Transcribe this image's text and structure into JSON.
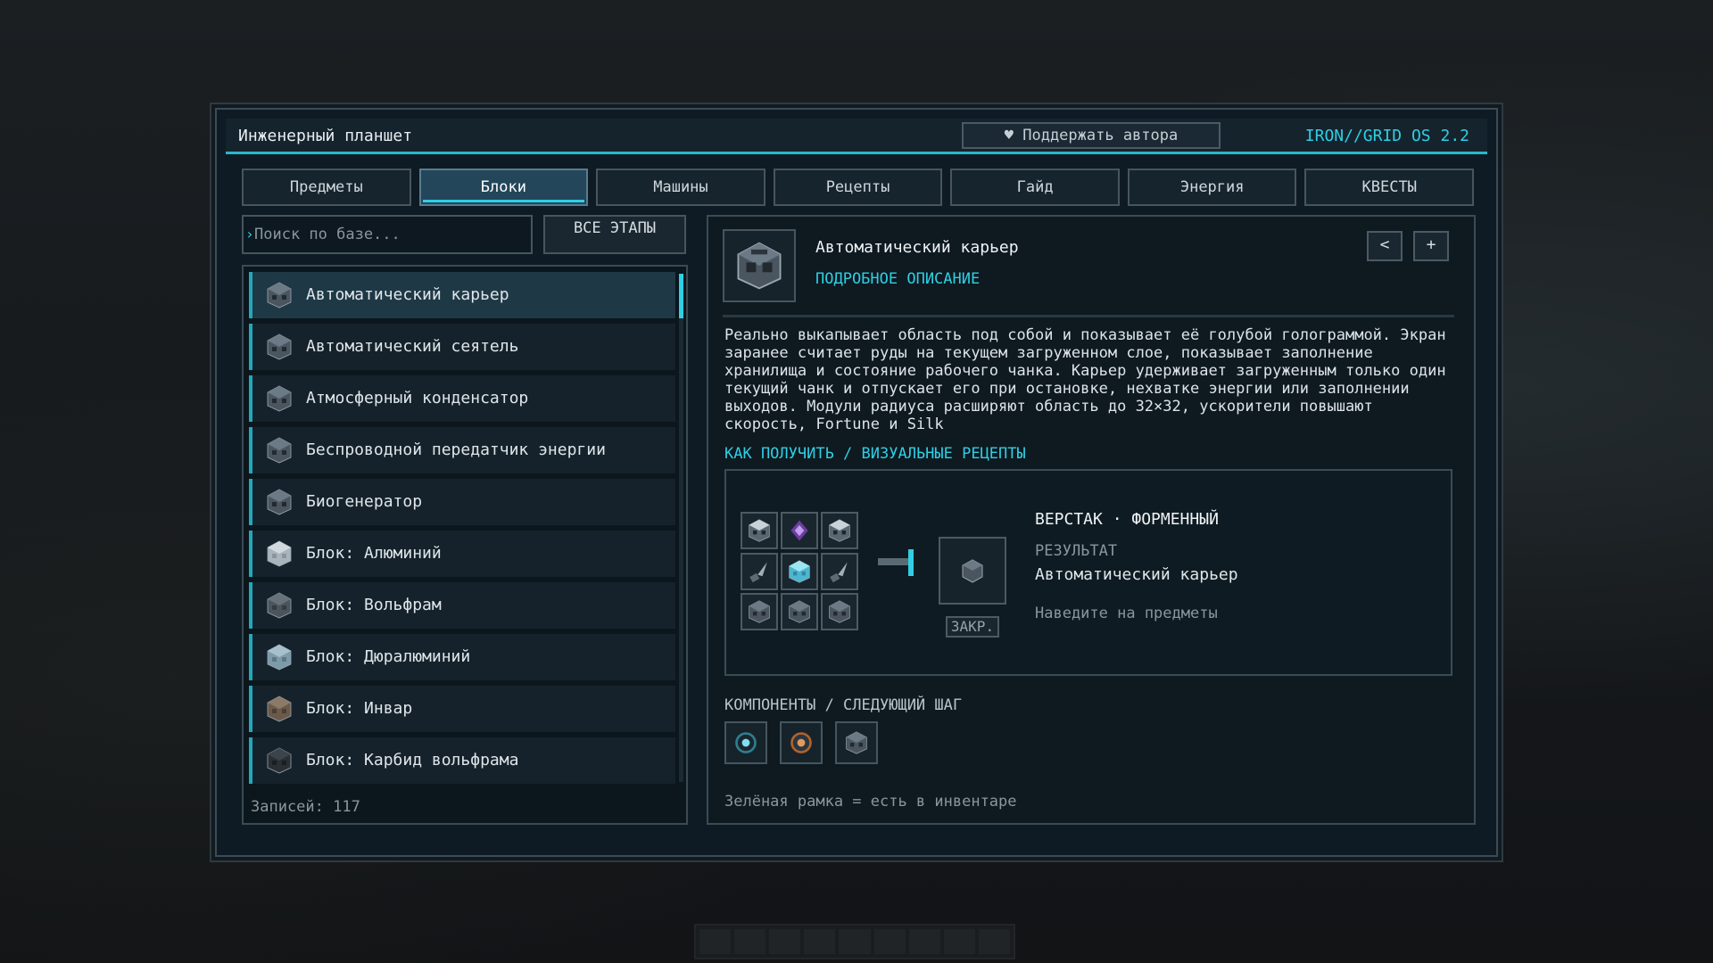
{
  "window": {
    "title": "Инженерный планшет",
    "support_button": "♥ Поддержать автора",
    "version": "IRON//GRID OS 2.2",
    "accent_color": "#2fcfe4"
  },
  "tabs": [
    {
      "label": "Предметы",
      "active": false
    },
    {
      "label": "Блоки",
      "active": true
    },
    {
      "label": "Машины",
      "active": false
    },
    {
      "label": "Рецепты",
      "active": false
    },
    {
      "label": "Гайд",
      "active": false
    },
    {
      "label": "Энергия",
      "active": false
    },
    {
      "label": "КВЕСТЫ",
      "active": false
    }
  ],
  "search": {
    "placeholder": "Поиск по базе...",
    "value": "",
    "filter_button": "ВСЕ ЭТАПЫ"
  },
  "list": {
    "items": [
      {
        "label": "Автоматический карьер",
        "icon": "machine-block-icon",
        "selected": true
      },
      {
        "label": "Автоматический сеятель",
        "icon": "machine-block-icon",
        "selected": false
      },
      {
        "label": "Атмосферный конденсатор",
        "icon": "machine-block-icon",
        "selected": false
      },
      {
        "label": "Беспроводной передатчик энергии",
        "icon": "machine-block-icon",
        "selected": false
      },
      {
        "label": "Биогенератор",
        "icon": "machine-block-icon",
        "selected": false
      },
      {
        "label": "Блок: Алюминий",
        "icon": "aluminium-block-icon",
        "selected": false
      },
      {
        "label": "Блок: Вольфрам",
        "icon": "tungsten-block-icon",
        "selected": false
      },
      {
        "label": "Блок: Дюралюминий",
        "icon": "duralumin-block-icon",
        "selected": false
      },
      {
        "label": "Блок: Инвар",
        "icon": "invar-block-icon",
        "selected": false
      },
      {
        "label": "Блок: Карбид вольфрама",
        "icon": "tungsten-carbide-block-icon",
        "selected": false
      }
    ],
    "count_label": "Записей: 117"
  },
  "detail": {
    "name": "Автоматический карьер",
    "detail_link": "ПОДРОБНОЕ ОПИСАНИЕ",
    "back_button": "<",
    "add_button": "+",
    "description": "Реально выкапывает область под собой и показывает её голубой голограммой. Экран заранее считает руды на текущем загруженном слое, показывает заполнение хранилища и состояние рабочего чанка. Карьер удерживает загруженным только один текущий чанк и отпускает его при остановке, нехватке энергии или заполнении выходов. Модули радиуса расширяют область до 32×32, ускорители повышают скорость, Fortune и Silk",
    "how_to_get": "КАК ПОЛУЧИТЬ / ВИЗУАЛЬНЫЕ РЕЦЕПТЫ",
    "recipe": {
      "station": "ВЕРСТАК · ФОРМЕННЫЙ",
      "result_label": "РЕЗУЛЬТАТ",
      "result_name": "Автоматический карьер",
      "hint": "Наведите на предметы",
      "locked_label": "ЗАКР.",
      "grid": [
        "frame-icon",
        "crystal-icon",
        "frame-icon",
        "drill-icon",
        "ice-block-icon",
        "drill-icon",
        "machine-block-icon",
        "machine-block-icon",
        "machine-block-icon"
      ]
    },
    "components_title": "КОМПОНЕНТЫ / СЛЕДУЮЩИЙ ШАГ",
    "components": [
      "core-icon",
      "processor-icon",
      "machine-block-icon"
    ],
    "legend": "Зелёная рамка = есть в инвентаре"
  }
}
